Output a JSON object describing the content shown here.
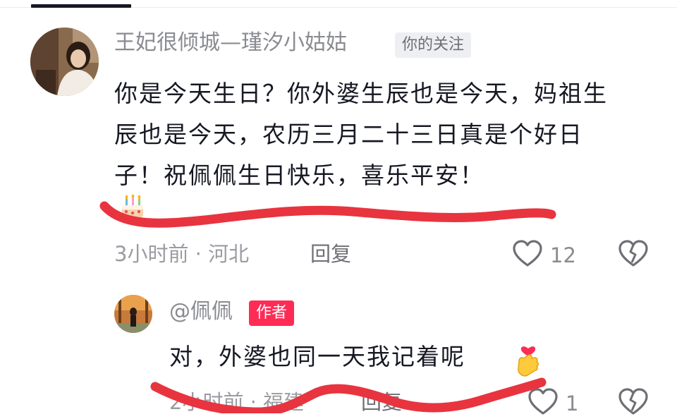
{
  "colors": {
    "accent": "#fe2c55",
    "scribble": "#e8343f",
    "meta": "#9b9ca2",
    "text": "#161823"
  },
  "comment": {
    "username": "王妃很倾城—瑾汐小姑姑",
    "follow_tag": "你的关注",
    "text": "你是今天生日？你外婆生辰也是今天，妈祖生辰也是今天，农历三月二十三日真是个好日子！祝佩佩生日快乐，喜乐平安！",
    "emoji": "cake-icon",
    "time_location": "3小时前 · 河北",
    "reply_label": "回复",
    "like_count": "12"
  },
  "reply": {
    "username": "@佩佩",
    "author_tag": "作者",
    "text": "对，外婆也同一天我记着呢",
    "emoji": "finger-heart-icon",
    "time_location": "2小时前 · 福建",
    "reply_label": "回复",
    "like_count": "1"
  }
}
